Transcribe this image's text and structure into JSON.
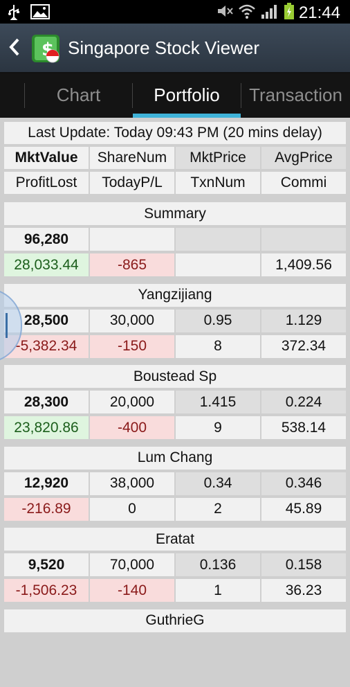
{
  "status_bar": {
    "time": "21:44"
  },
  "app": {
    "title": "Singapore Stock Viewer"
  },
  "tabs": [
    {
      "label": "Chart",
      "active": false
    },
    {
      "label": "Portfolio",
      "active": true
    },
    {
      "label": "Transaction",
      "active": false
    }
  ],
  "info": {
    "last_update": "Last Update: Today  09:43 PM (20 mins delay)",
    "headers_row1": [
      "MktValue",
      "ShareNum",
      "MktPrice",
      "AvgPrice"
    ],
    "headers_row2": [
      "ProfitLost",
      "TodayP/L",
      "TxnNum",
      "Commi"
    ]
  },
  "stocks": [
    {
      "name": "Summary",
      "row1": [
        "96,280",
        "",
        "",
        ""
      ],
      "row2": [
        "28,033.44",
        "-865",
        "",
        "1,409.56"
      ],
      "profit_status": "gain",
      "today_status": "loss"
    },
    {
      "name": "Yangzijiang",
      "row1": [
        "28,500",
        "30,000",
        "0.95",
        "1.129"
      ],
      "row2": [
        "-5,382.34",
        "-150",
        "8",
        "372.34"
      ],
      "profit_status": "loss",
      "today_status": "loss"
    },
    {
      "name": "Boustead Sp",
      "row1": [
        "28,300",
        "20,000",
        "1.415",
        "0.224"
      ],
      "row2": [
        "23,820.86",
        "-400",
        "9",
        "538.14"
      ],
      "profit_status": "gain",
      "today_status": "loss"
    },
    {
      "name": "Lum Chang",
      "row1": [
        "12,920",
        "38,000",
        "0.34",
        "0.346"
      ],
      "row2": [
        "-216.89",
        "0",
        "2",
        "45.89"
      ],
      "profit_status": "loss",
      "today_status": "neutral"
    },
    {
      "name": "Eratat",
      "row1": [
        "9,520",
        "70,000",
        "0.136",
        "0.158"
      ],
      "row2": [
        "-1,506.23",
        "-140",
        "1",
        "36.23"
      ],
      "profit_status": "loss",
      "today_status": "loss"
    },
    {
      "name": "GuthrieG",
      "row1": [],
      "row2": []
    }
  ],
  "colors": {
    "gain": "#dff5df",
    "loss": "#f9dcdc",
    "accent": "#3fb3d9"
  }
}
